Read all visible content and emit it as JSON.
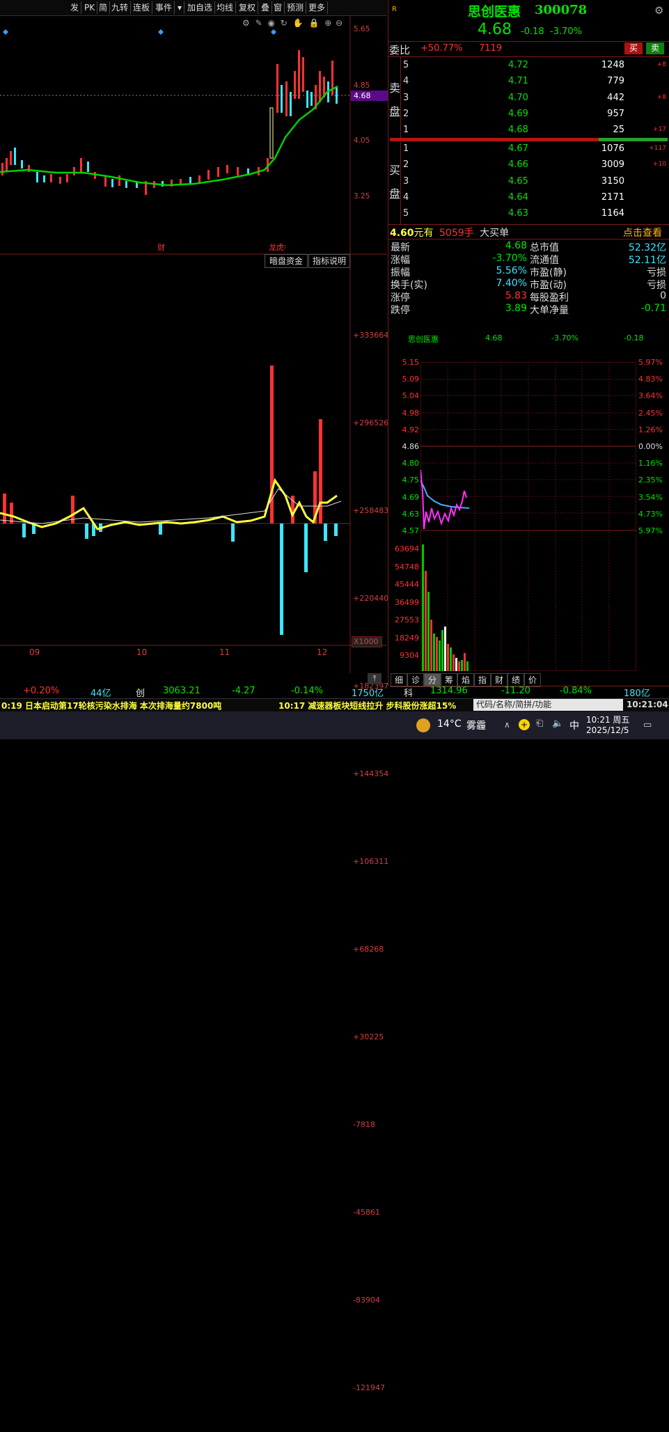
{
  "toolbar": {
    "items": [
      "发",
      "PK",
      "简",
      "九转",
      "连板",
      "事件",
      "▾",
      "加自选",
      "均线",
      "复权",
      "叠",
      "窗",
      "预测",
      "更多"
    ]
  },
  "stock": {
    "badge": "R",
    "name": "思创医惠",
    "code": "300078",
    "price": "4.68",
    "change": "-0.18",
    "change_pct": "-3.70%"
  },
  "weibi": {
    "label": "委比",
    "pct": "+50.77%",
    "diff": "7119",
    "buy_btn": "买",
    "sell_btn": "卖"
  },
  "sell_label": "卖\n盘",
  "buy_label": "买\n盘",
  "asks": [
    {
      "level": "5",
      "price": "4.72",
      "vol": "1248",
      "delta": "+8"
    },
    {
      "level": "4",
      "price": "4.71",
      "vol": "779",
      "delta": ""
    },
    {
      "level": "3",
      "price": "4.70",
      "vol": "442",
      "delta": "+8"
    },
    {
      "level": "2",
      "price": "4.69",
      "vol": "957",
      "delta": ""
    },
    {
      "level": "1",
      "price": "4.68",
      "vol": "25",
      "delta": "+17"
    }
  ],
  "bids": [
    {
      "level": "1",
      "price": "4.67",
      "vol": "1076",
      "delta": "+117"
    },
    {
      "level": "2",
      "price": "4.66",
      "vol": "3009",
      "delta": "+10"
    },
    {
      "level": "3",
      "price": "4.65",
      "vol": "3150",
      "delta": ""
    },
    {
      "level": "4",
      "price": "4.64",
      "vol": "2171",
      "delta": ""
    },
    {
      "level": "5",
      "price": "4.63",
      "vol": "1164",
      "delta": ""
    }
  ],
  "bigorder": {
    "price": "4.60",
    "text1": "元有",
    "qty": "5059手",
    "text2": "大买单",
    "link": "点击查看"
  },
  "stats": [
    {
      "l1": "最新",
      "v1": "4.68",
      "l2": "总市值",
      "v2": "52.32亿"
    },
    {
      "l1": "涨幅",
      "v1": "-3.70%",
      "l2": "流通值",
      "v2": "52.11亿"
    },
    {
      "l1": "振幅",
      "v1": "5.56%",
      "l2": "市盈(静)",
      "v2": "亏损"
    },
    {
      "l1": "换手(实)",
      "v1": "7.40%",
      "l2": "市盈(动)",
      "v2": "亏损"
    },
    {
      "l1": "涨停",
      "v1": "5.83",
      "l2": "每股盈利",
      "v2": "0"
    },
    {
      "l1": "跌停",
      "v1": "3.89",
      "l2": "大单净量",
      "v2": "-0.71"
    }
  ],
  "mini": {
    "name": "思创医惠",
    "price": "4.68",
    "pct": "-3.70%",
    "chg": "-0.18",
    "left_axis": [
      "5.15",
      "5.09",
      "5.04",
      "4.98",
      "4.92",
      "4.86",
      "4.80",
      "4.75",
      "4.69",
      "4.63",
      "4.57"
    ],
    "right_axis": [
      "5.97%",
      "4.83%",
      "3.64%",
      "2.45%",
      "1.26%",
      "0.00%",
      "1.16%",
      "2.35%",
      "3.54%",
      "4.73%",
      "5.97%"
    ],
    "vol_axis": [
      "63694",
      "54748",
      "45444",
      "36499",
      "27553",
      "18249",
      "9304"
    ],
    "tabs": [
      "细",
      "诊",
      "分",
      "筹",
      "焰",
      "指",
      "财",
      "绩",
      "价"
    ]
  },
  "kchart": {
    "price_axis": [
      "5.65",
      "4.85",
      "4.68",
      "4.05",
      "3.25"
    ],
    "markers": [
      "财",
      "龙虎榜"
    ],
    "btn1": "暗盘资金",
    "btn2": "指标说明",
    "ind_axis": [
      "+333664",
      "+296526",
      "+258483",
      "+220440",
      "+182397",
      "+144354",
      "+106311",
      "+68268",
      "+30225",
      "-7818",
      "-45861",
      "-83904",
      "-121947"
    ],
    "unit": "X1000",
    "months": [
      "09",
      "10",
      "11",
      "12"
    ]
  },
  "bottom": {
    "idx1_pct": "+0.20%",
    "idx1_amt": "44亿",
    "idx2_name": "创",
    "idx2_val": "3063.21",
    "idx2_chg": "-4.27",
    "idx2_pct": "-0.14%",
    "idx2_amt": "1750亿",
    "idx3_name": "科",
    "idx3_val": "1314.96",
    "idx3_chg": "-11.20",
    "idx3_pct": "-0.84%",
    "idx3_amt": "180亿"
  },
  "news": {
    "left": "0:19 日本启动第17轮核污染水排海 本次排海量约7800吨",
    "right": "10:17 减速器板块短线拉升 步科股份涨超15%",
    "search": "代码/名称/简拼/功能",
    "clock": "10:21:04"
  },
  "taskbar": {
    "temp": "14°C",
    "weather": "雾霾",
    "lang": "中",
    "time": "10:21 周五",
    "date": "2025/12/5"
  },
  "colors": {
    "up": "#ff3232",
    "down": "#00e600",
    "cyan": "#3ce6ff",
    "yellow": "#ffff3c",
    "border": "#7a1a1a"
  }
}
